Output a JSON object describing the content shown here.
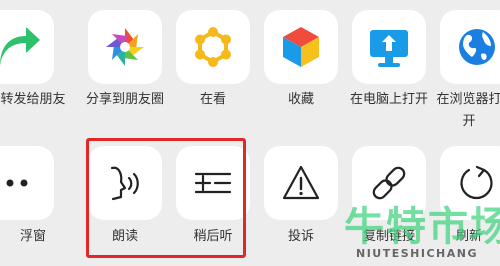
{
  "share_row": [
    {
      "name": "share-to-friend",
      "label": "转发给朋友",
      "icon": "share-arrow-icon"
    },
    {
      "name": "share-to-moments",
      "label": "分享到朋友圈",
      "icon": "moments-aperture-icon"
    },
    {
      "name": "wow",
      "label": "在看",
      "icon": "wow-star-icon"
    },
    {
      "name": "favorite",
      "label": "收藏",
      "icon": "cube-favorite-icon"
    },
    {
      "name": "open-on-pc",
      "label": "在电脑上打开",
      "icon": "monitor-upload-icon"
    },
    {
      "name": "open-in-browser",
      "label": "在浏览器打开",
      "icon": "globe-icon"
    }
  ],
  "action_row": [
    {
      "name": "floating-window",
      "label": "浮窗",
      "icon": "more-dots-icon"
    },
    {
      "name": "read-aloud",
      "label": "朗读",
      "icon": "read-aloud-icon"
    },
    {
      "name": "listen-later",
      "label": "稍后听",
      "icon": "listen-later-icon"
    },
    {
      "name": "report",
      "label": "投诉",
      "icon": "warning-icon"
    },
    {
      "name": "copy-link",
      "label": "复制链接",
      "icon": "link-icon"
    },
    {
      "name": "refresh",
      "label": "刷新",
      "icon": "refresh-icon"
    }
  ],
  "watermark": {
    "chinese": "牛特市场",
    "english": "NIUTESHICHANG"
  },
  "colors": {
    "highlight": "#e3262a",
    "green": "#2ec16b",
    "gold": "#f6b91c",
    "blue": "#1a9be8",
    "red": "#e8453c",
    "watermark": "#39d37a"
  }
}
